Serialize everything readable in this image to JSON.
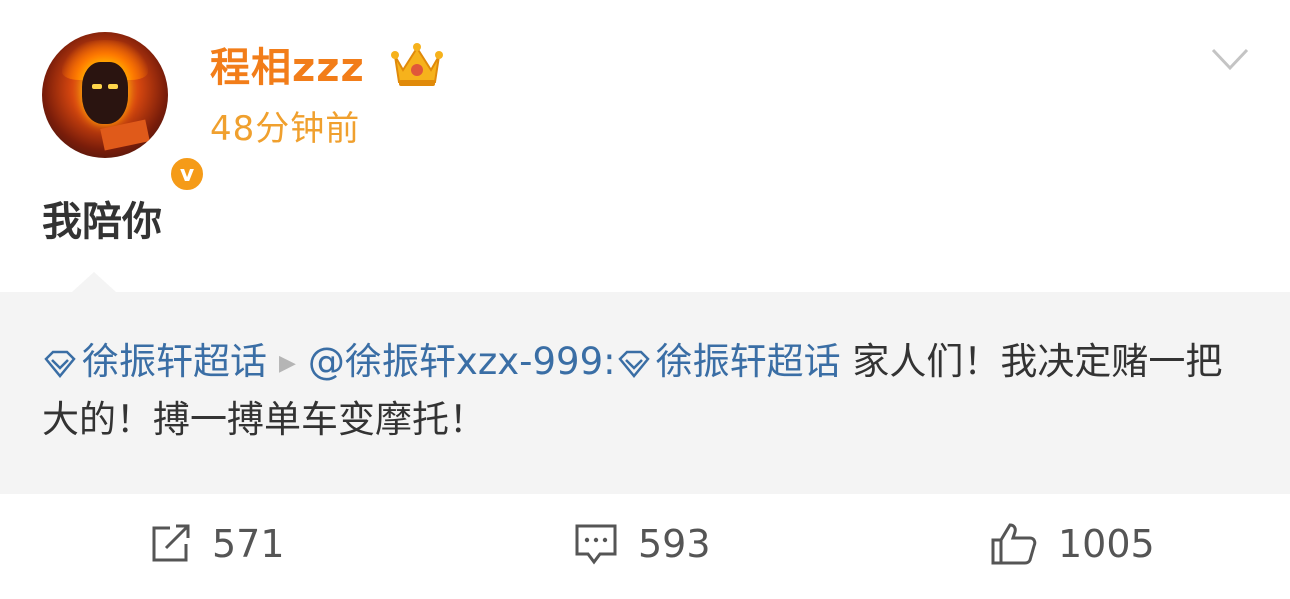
{
  "post": {
    "username": "程相zzz",
    "timestamp": "48分钟前",
    "text": "我陪你",
    "verified": true
  },
  "repost": {
    "topic_prefix": "徐振轩超话",
    "author_mention": "@徐振轩xzx-999:",
    "topic_inline": "徐振轩超话",
    "body": " 家人们！我决定赌一把大的！搏一搏单车变摩托！"
  },
  "actions": {
    "repost_count": "571",
    "comment_count": "593",
    "like_count": "1005"
  },
  "colors": {
    "username": "#f27d19",
    "timestamp": "#f0a02e",
    "link": "#3a6ea5",
    "repost_bg": "#f4f4f4",
    "verified_badge": "#f59b18"
  },
  "icons": {
    "crown": "crown-icon",
    "verified": "verified-v-icon",
    "more": "chevron-down-icon",
    "topic": "diamond-icon",
    "repost": "repost-icon",
    "comment": "comment-icon",
    "like": "thumbs-up-icon"
  }
}
